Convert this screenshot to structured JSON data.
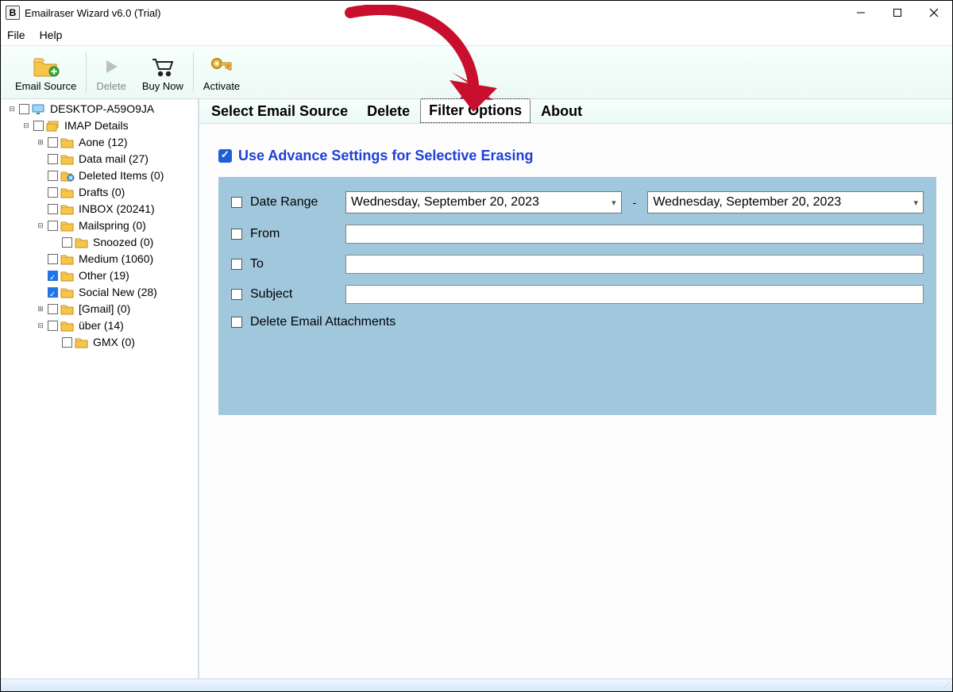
{
  "window": {
    "title": "Emailraser Wizard v6.0 (Trial)"
  },
  "menu": {
    "file": "File",
    "help": "Help"
  },
  "toolbar": {
    "email_source": "Email Source",
    "delete": "Delete",
    "buy_now": "Buy Now",
    "activate": "Activate"
  },
  "tree": {
    "root": "DESKTOP-A59O9JA",
    "imap": "IMAP Details",
    "items": [
      {
        "label": "Aone (12)",
        "checked": false,
        "exp": "plus"
      },
      {
        "label": "Data mail (27)",
        "checked": false,
        "exp": ""
      },
      {
        "label": "Deleted Items (0)",
        "checked": false,
        "exp": "",
        "deleted": true
      },
      {
        "label": "Drafts (0)",
        "checked": false,
        "exp": ""
      },
      {
        "label": "INBOX (20241)",
        "checked": false,
        "exp": ""
      },
      {
        "label": "Mailspring (0)",
        "checked": false,
        "exp": "minus",
        "children": [
          {
            "label": "Snoozed (0)",
            "checked": false
          }
        ]
      },
      {
        "label": "Medium (1060)",
        "checked": false,
        "exp": ""
      },
      {
        "label": "Other (19)",
        "checked": true,
        "exp": ""
      },
      {
        "label": "Social New (28)",
        "checked": true,
        "exp": ""
      },
      {
        "label": "[Gmail] (0)",
        "checked": false,
        "exp": "plus"
      },
      {
        "label": "über (14)",
        "checked": false,
        "exp": "minus",
        "children": [
          {
            "label": "GMX (0)",
            "checked": false
          }
        ]
      }
    ]
  },
  "tabs": {
    "select": "Select Email Source",
    "delete": "Delete",
    "filter": "Filter Options",
    "about": "About",
    "active": "filter"
  },
  "filter": {
    "advance_label": "Use Advance Settings for Selective Erasing",
    "advance_checked": true,
    "rows": {
      "date_range": "Date Range",
      "from": "From",
      "to": "To",
      "subject": "Subject",
      "delete_attach": "Delete Email Attachments"
    },
    "date1": "Wednesday, September 20, 2023",
    "date2": "Wednesday, September 20, 2023"
  },
  "icons": {
    "folder_add": "folder-add-icon",
    "play": "play-icon",
    "cart": "cart-icon",
    "key": "key-icon",
    "monitor": "monitor-icon",
    "folders": "folders-icon",
    "folder": "folder-icon",
    "trash_folder": "trash-folder-icon"
  },
  "colors": {
    "accent_blue": "#1e5fd8",
    "panel_blue": "#a1c7dd",
    "toolbar_grad_top": "#f6fffc",
    "toolbar_grad_bot": "#ecf9f5"
  }
}
